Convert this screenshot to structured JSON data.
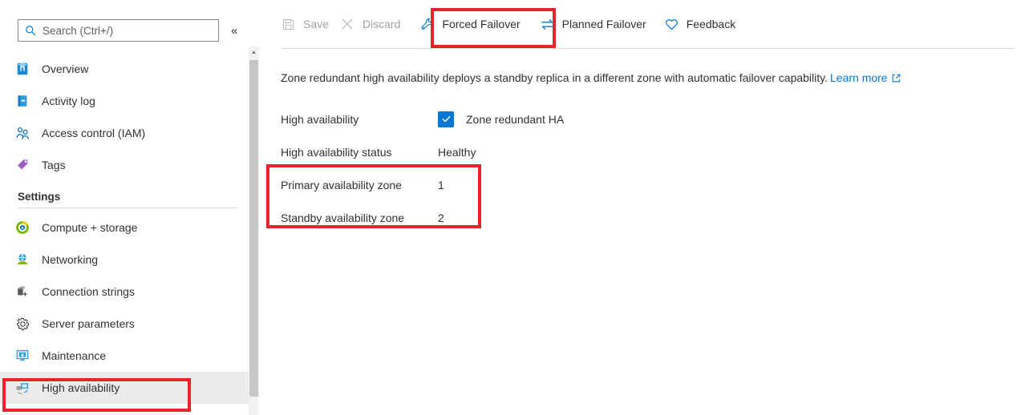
{
  "sidebar": {
    "search": {
      "placeholder": "Search (Ctrl+/)",
      "value": "",
      "icon": "search-icon"
    },
    "collapse_label": "«",
    "items": [
      {
        "label": "Overview",
        "icon": "database-icon"
      },
      {
        "label": "Activity log",
        "icon": "activity-log-icon"
      },
      {
        "label": "Access control (IAM)",
        "icon": "access-control-icon"
      },
      {
        "label": "Tags",
        "icon": "tag-icon"
      }
    ],
    "settings_group": {
      "heading": "Settings",
      "items": [
        {
          "label": "Compute + storage",
          "icon": "compute-storage-icon"
        },
        {
          "label": "Networking",
          "icon": "networking-icon"
        },
        {
          "label": "Connection strings",
          "icon": "connection-strings-icon"
        },
        {
          "label": "Server parameters",
          "icon": "gear-icon"
        },
        {
          "label": "Maintenance",
          "icon": "maintenance-icon"
        },
        {
          "label": "High availability",
          "icon": "high-availability-icon",
          "selected": true
        }
      ]
    },
    "scroll_up_glyph": "▲"
  },
  "toolbar": {
    "items": [
      {
        "label": "Save",
        "icon": "save-icon",
        "disabled": true
      },
      {
        "label": "Discard",
        "icon": "discard-icon",
        "disabled": true
      },
      {
        "label": "Forced Failover",
        "icon": "wrench-icon",
        "disabled": false
      },
      {
        "label": "Planned Failover",
        "icon": "swap-arrows-icon",
        "disabled": false
      },
      {
        "label": "Feedback",
        "icon": "heart-icon",
        "disabled": false
      }
    ]
  },
  "content": {
    "description": "Zone redundant high availability deploys a standby replica in a different zone with automatic failover capability.",
    "learn_more": "Learn more",
    "rows": [
      {
        "label": "High availability",
        "value": "Zone redundant HA",
        "checkbox": true,
        "checked": true
      },
      {
        "label": "High availability status",
        "value": "Healthy",
        "checkbox": false
      },
      {
        "label": "Primary availability zone",
        "value": "1",
        "checkbox": false
      },
      {
        "label": "Standby availability zone",
        "value": "2",
        "checkbox": false
      }
    ]
  },
  "annotations": {
    "color": "#e8232a",
    "boxes": [
      "forced-failover-button",
      "availability-zone-rows",
      "high-availability-nav-item"
    ]
  }
}
